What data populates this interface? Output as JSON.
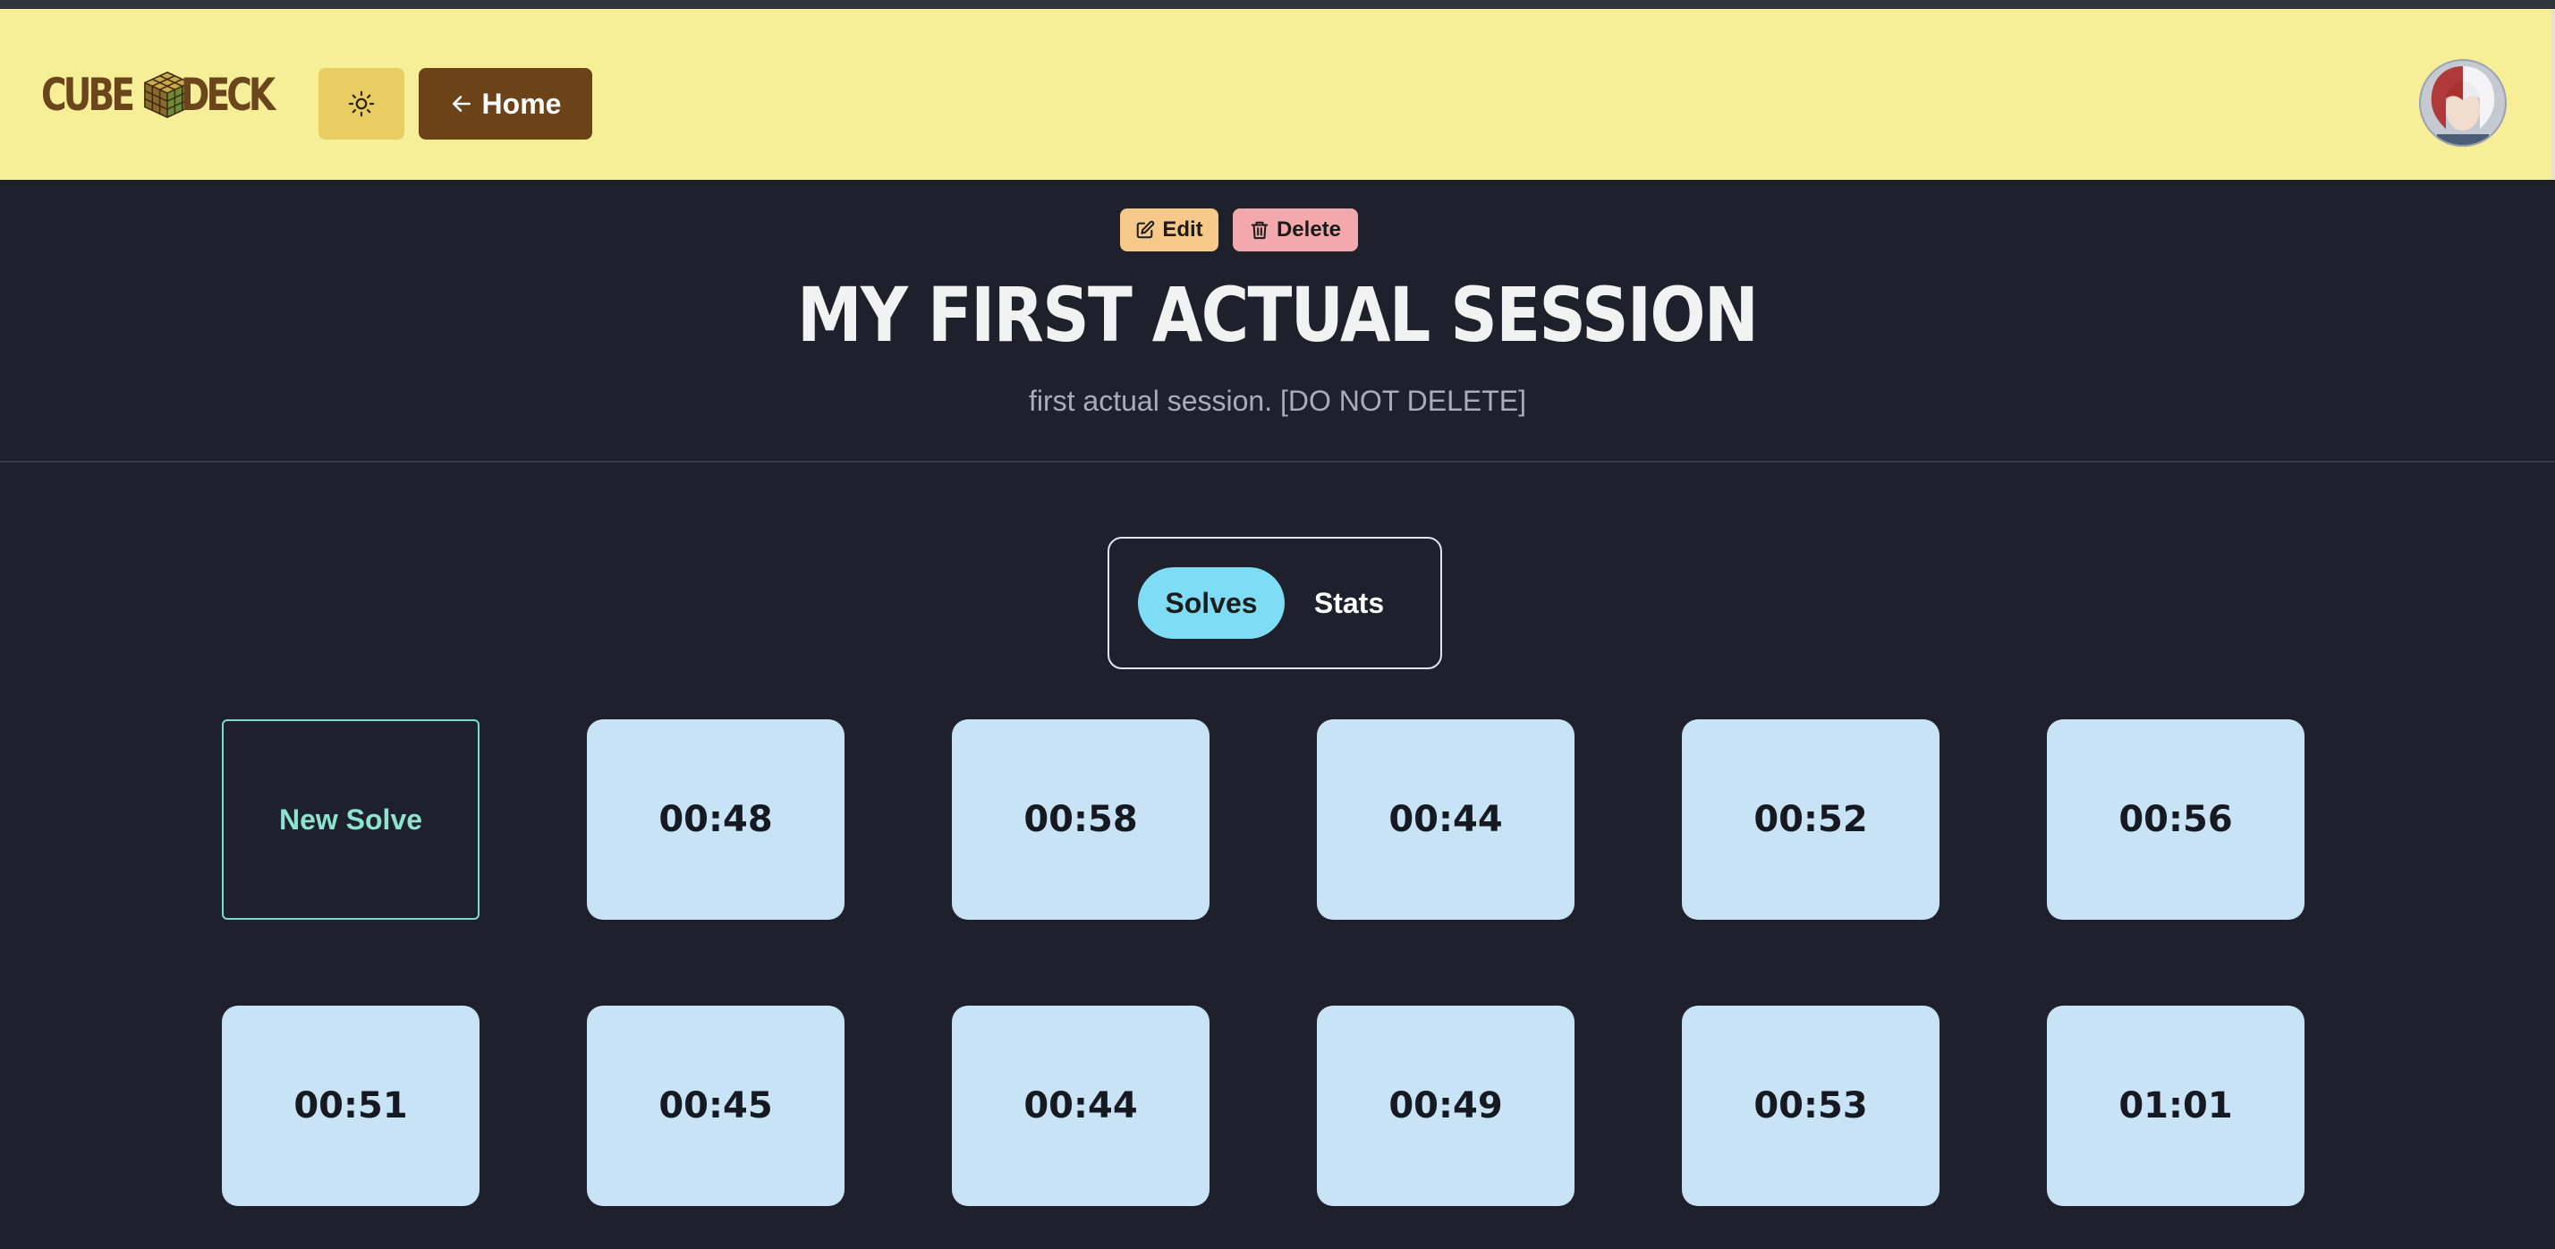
{
  "navbar": {
    "logo": {
      "part1": "CUBE",
      "part2": "DECK",
      "icon": "rubiks-cube-icon"
    },
    "theme_toggle_icon": "sun-icon",
    "home_label": "Home",
    "home_icon": "arrow-left-icon",
    "avatar_icon": "user-avatar",
    "background": "#f6ef98",
    "accent": "#6c4219"
  },
  "session": {
    "edit_label": "Edit",
    "edit_icon": "edit-icon",
    "delete_label": "Delete",
    "delete_icon": "trash-icon",
    "title": "MY FIRST ACTUAL SESSION",
    "description": "first actual session. [DO NOT DELETE]"
  },
  "tabs": {
    "items": [
      {
        "label": "Solves",
        "active": true
      },
      {
        "label": "Stats",
        "active": false
      }
    ]
  },
  "solves": {
    "new_solve_label": "New Solve",
    "times": [
      "00:48",
      "00:58",
      "00:44",
      "00:52",
      "00:56",
      "00:51",
      "00:45",
      "00:44",
      "00:49",
      "00:53",
      "01:01"
    ]
  },
  "colors": {
    "page_bg": "#1e212b",
    "card_bg": "#c8e2f6",
    "active_tab": "#7fdcf5",
    "new_solve_border": "#7fd9c9",
    "edit_bg": "#f6c98a",
    "delete_bg": "#f2a8ac"
  }
}
